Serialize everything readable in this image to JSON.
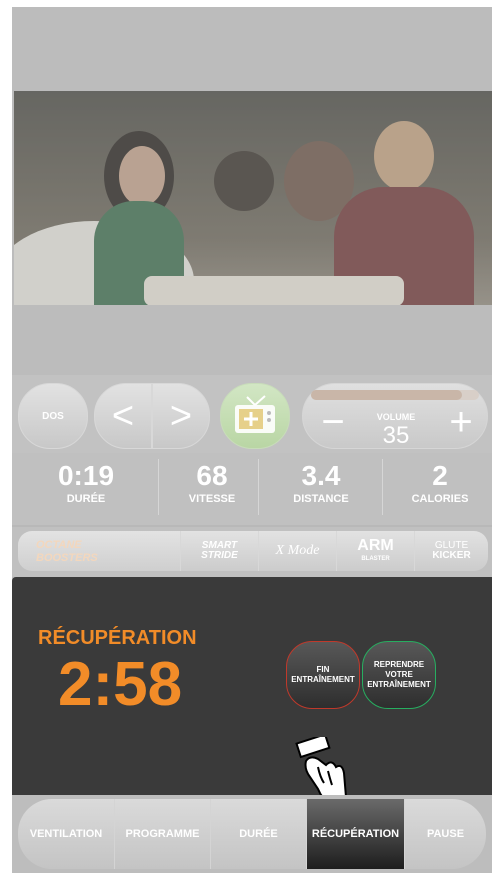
{
  "controls": {
    "dos_label": "DOS",
    "prev_symbol": "<",
    "next_symbol": ">",
    "volume_label": "VOLUME",
    "volume_value": "35",
    "volume_minus": "−",
    "volume_plus": "+",
    "volume_level_fraction": 0.9
  },
  "stats": [
    {
      "value": "0:19",
      "label": "DURÉE"
    },
    {
      "value": "68",
      "label": "VITESSE"
    },
    {
      "value": "3.4",
      "label": "DISTANCE"
    },
    {
      "value": "2",
      "label": "CALORIES"
    }
  ],
  "boosters": {
    "label_line1": "OCTANE",
    "label_line2": "BOOSTERS",
    "items": [
      {
        "line1": "SMART",
        "line2": "STRIDE"
      },
      {
        "line1": "X Mode",
        "line2": ""
      },
      {
        "line1": "ARM",
        "line2": "BLASTER"
      },
      {
        "line1": "GLUTE",
        "line2": "KICKER"
      }
    ]
  },
  "recovery": {
    "title": "RÉCUPÉRATION",
    "time": "2:58",
    "end_button": {
      "line1": "FIN",
      "line2": "ENTRAÎNEMENT"
    },
    "resume_button": {
      "line1": "REPRENDRE",
      "line2": "VOTRE",
      "line3": "ENTRAÎNEMENT"
    }
  },
  "tabs": [
    {
      "label": "VENTILATION",
      "active": false
    },
    {
      "label": "PROGRAMME",
      "active": false
    },
    {
      "label": "DURÉE",
      "active": false
    },
    {
      "label": "RÉCUPÉRATION",
      "active": true
    },
    {
      "label": "PAUSE",
      "active": false
    }
  ],
  "colors": {
    "accent_orange": "#f28c28",
    "end_red": "#c0392b",
    "resume_green": "#27ae60",
    "panel_dark": "#3a3a3a"
  }
}
